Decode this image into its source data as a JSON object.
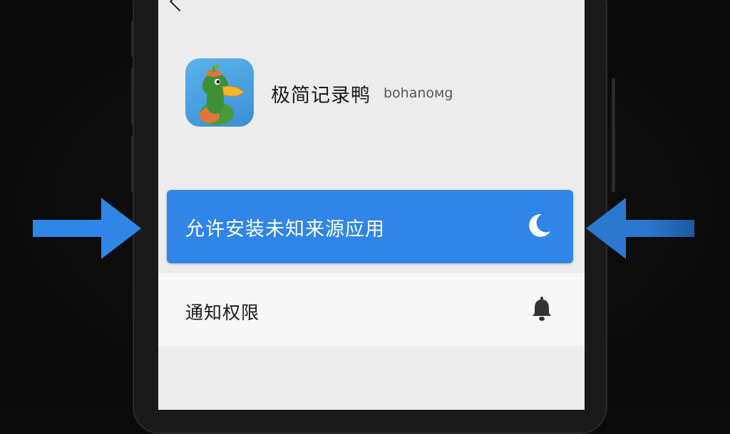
{
  "app": {
    "name": "极简记录鸭",
    "developer": "bohanoмg"
  },
  "menu": {
    "highlighted_item": "允许安装未知来源应用",
    "items": [
      {
        "label": "通知权限",
        "icon": "bell-icon"
      }
    ]
  },
  "icons": {
    "highlighted_item_icon": "moon-icon",
    "back": "back-chevron-icon",
    "pointer_arrows": "arrow-right-icon, arrow-left-icon"
  },
  "colors": {
    "highlight": "#2f86e6",
    "arrow": "#2f86e6",
    "screen_bg": "#ececec"
  }
}
